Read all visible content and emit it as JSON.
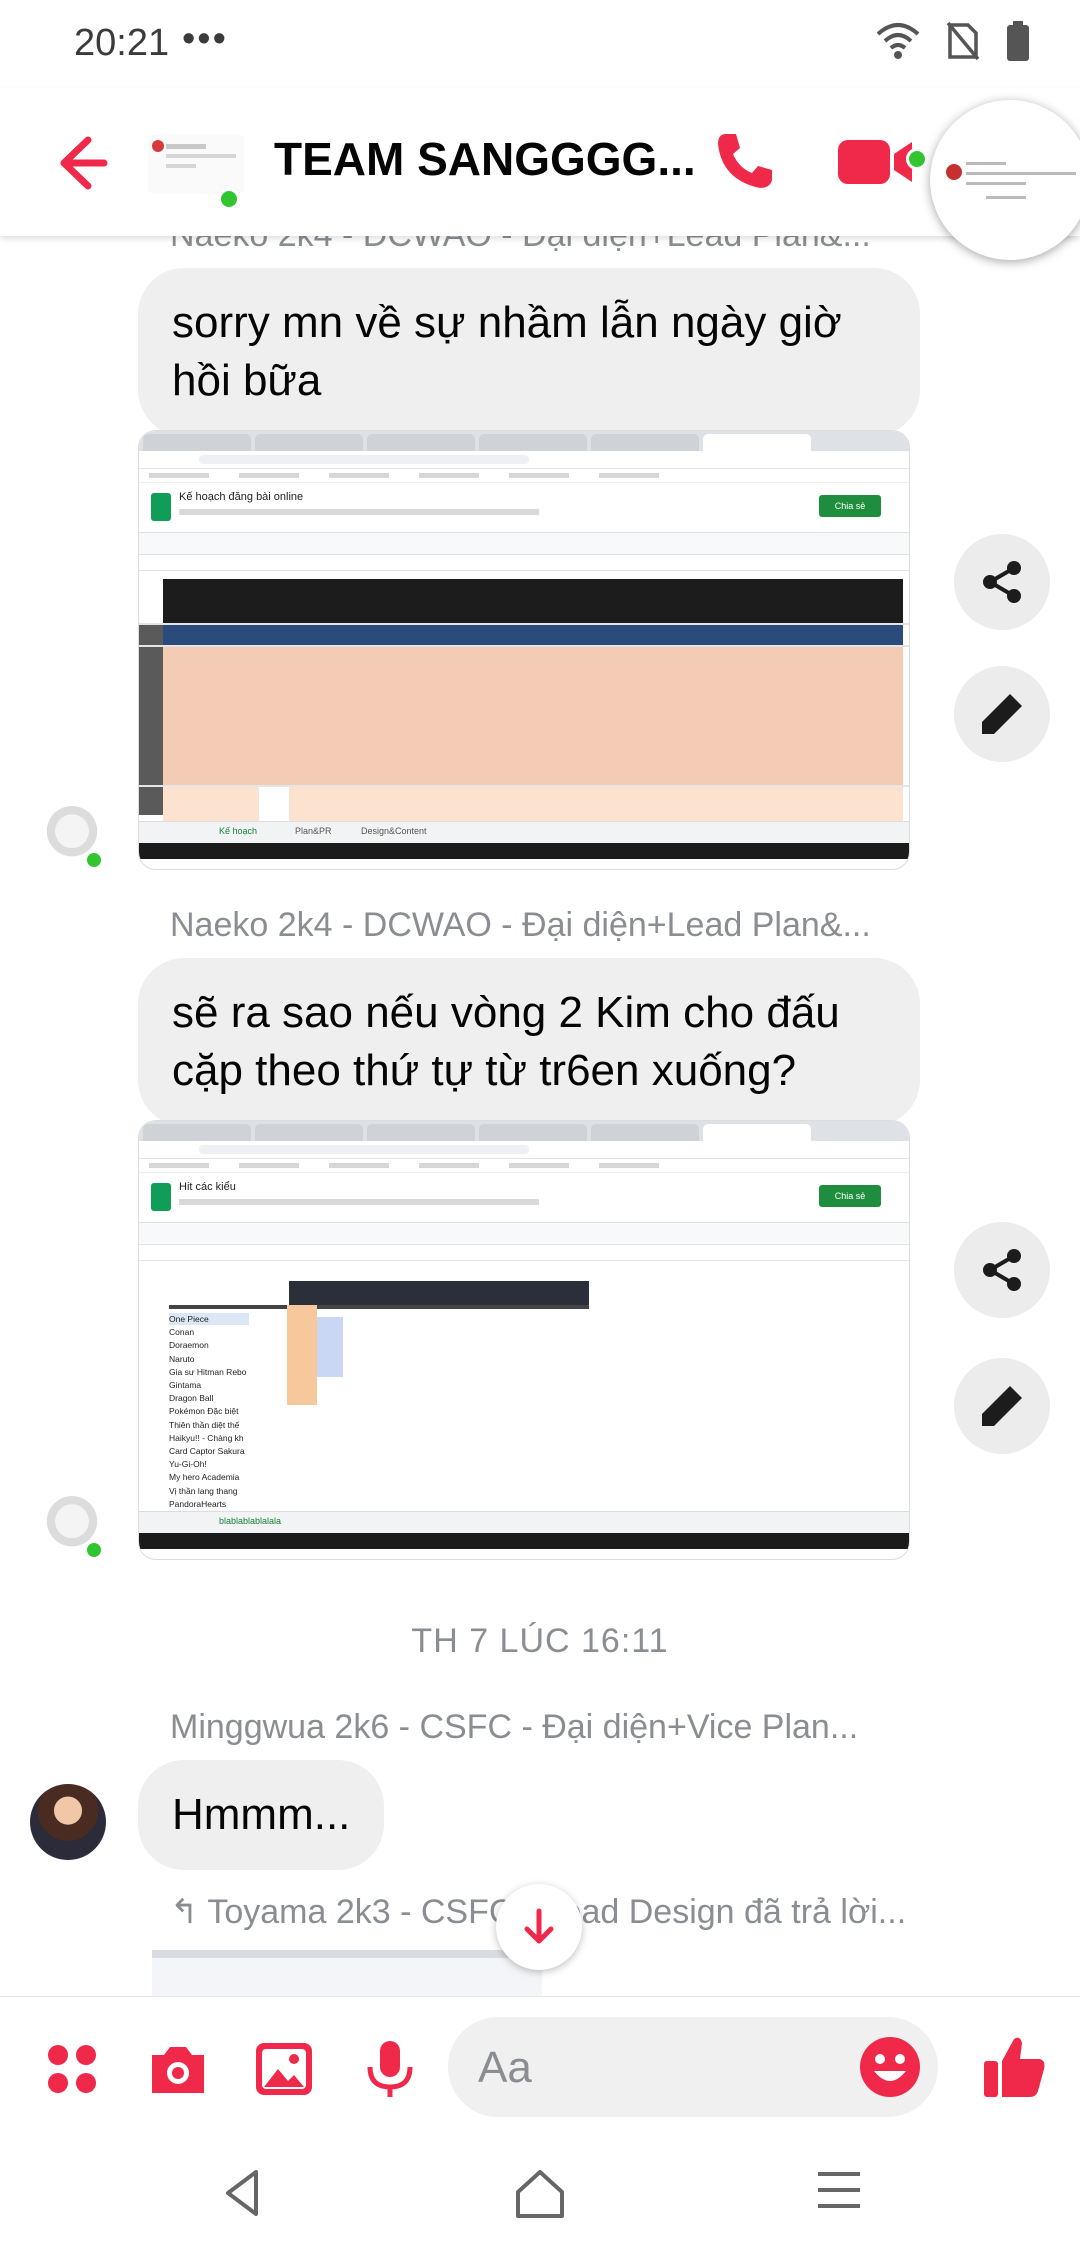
{
  "status_bar": {
    "time": "20:21",
    "dots": "•••",
    "icons": [
      "wifi-icon",
      "no-sim-icon",
      "battery-icon"
    ]
  },
  "header": {
    "title": "TEAM SANGGGG...",
    "icons": [
      "back-arrow-icon",
      "phone-icon",
      "video-camera-icon"
    ],
    "accent_color": "#f02849"
  },
  "messages": [
    {
      "sender": "Naeko 2k4 - DCWAO - Đại diện+Lead Plan&...",
      "text": "sorry mn về sự nhầm lẫn ngày giờ hồi bữa"
    },
    {
      "type": "image",
      "sheet_title": "Kế hoạch đăng bài online",
      "sheet_tab_1": "Kế hoạch",
      "sheet_tab_2": "Plan&PR",
      "sheet_tab_3": "Design&Content",
      "share_label": "Chia sẻ"
    },
    {
      "sender": "Naeko 2k4 - DCWAO - Đại diện+Lead Plan&...",
      "text": "sẽ ra sao nếu vòng 2 Kim cho đấu cặp theo thứ tự từ tr6en xuống?"
    },
    {
      "type": "image",
      "sheet_title": "Hit các kiểu",
      "sheet_tab_1": "blablablablalala",
      "share_label": "Chia sẻ",
      "rows": [
        "One Piece",
        "Conan",
        "Doraemon",
        "Naruto",
        "Gia sư Hitman Rebo",
        "Gintama",
        "Dragon Ball",
        "Pokémon Đặc biệt",
        "Thiên thần diệt thế",
        "Haikyu!! - Chàng kh",
        "Card Captor Sakura",
        "Yu-Gi-Oh!",
        "My hero Academia",
        "Vị thần lang thang",
        "PandoraHearts"
      ]
    }
  ],
  "time_separator": "TH 7 LÚC 16:11",
  "second_sender": "Minggwua 2k6 - CSFC - Đại diện+Vice Plan...",
  "second_text": "Hmmm...",
  "reply_line": "Toyama 2k3 - CSFC - Lead Design đã trả lời...",
  "composer": {
    "placeholder": "Aa",
    "icons": [
      "apps-icon",
      "camera-icon",
      "gallery-icon",
      "microphone-icon",
      "emoji-icon",
      "thumbs-up-icon"
    ]
  },
  "nav": {
    "icons": [
      "nav-back-icon",
      "nav-home-icon",
      "nav-recents-icon"
    ]
  }
}
